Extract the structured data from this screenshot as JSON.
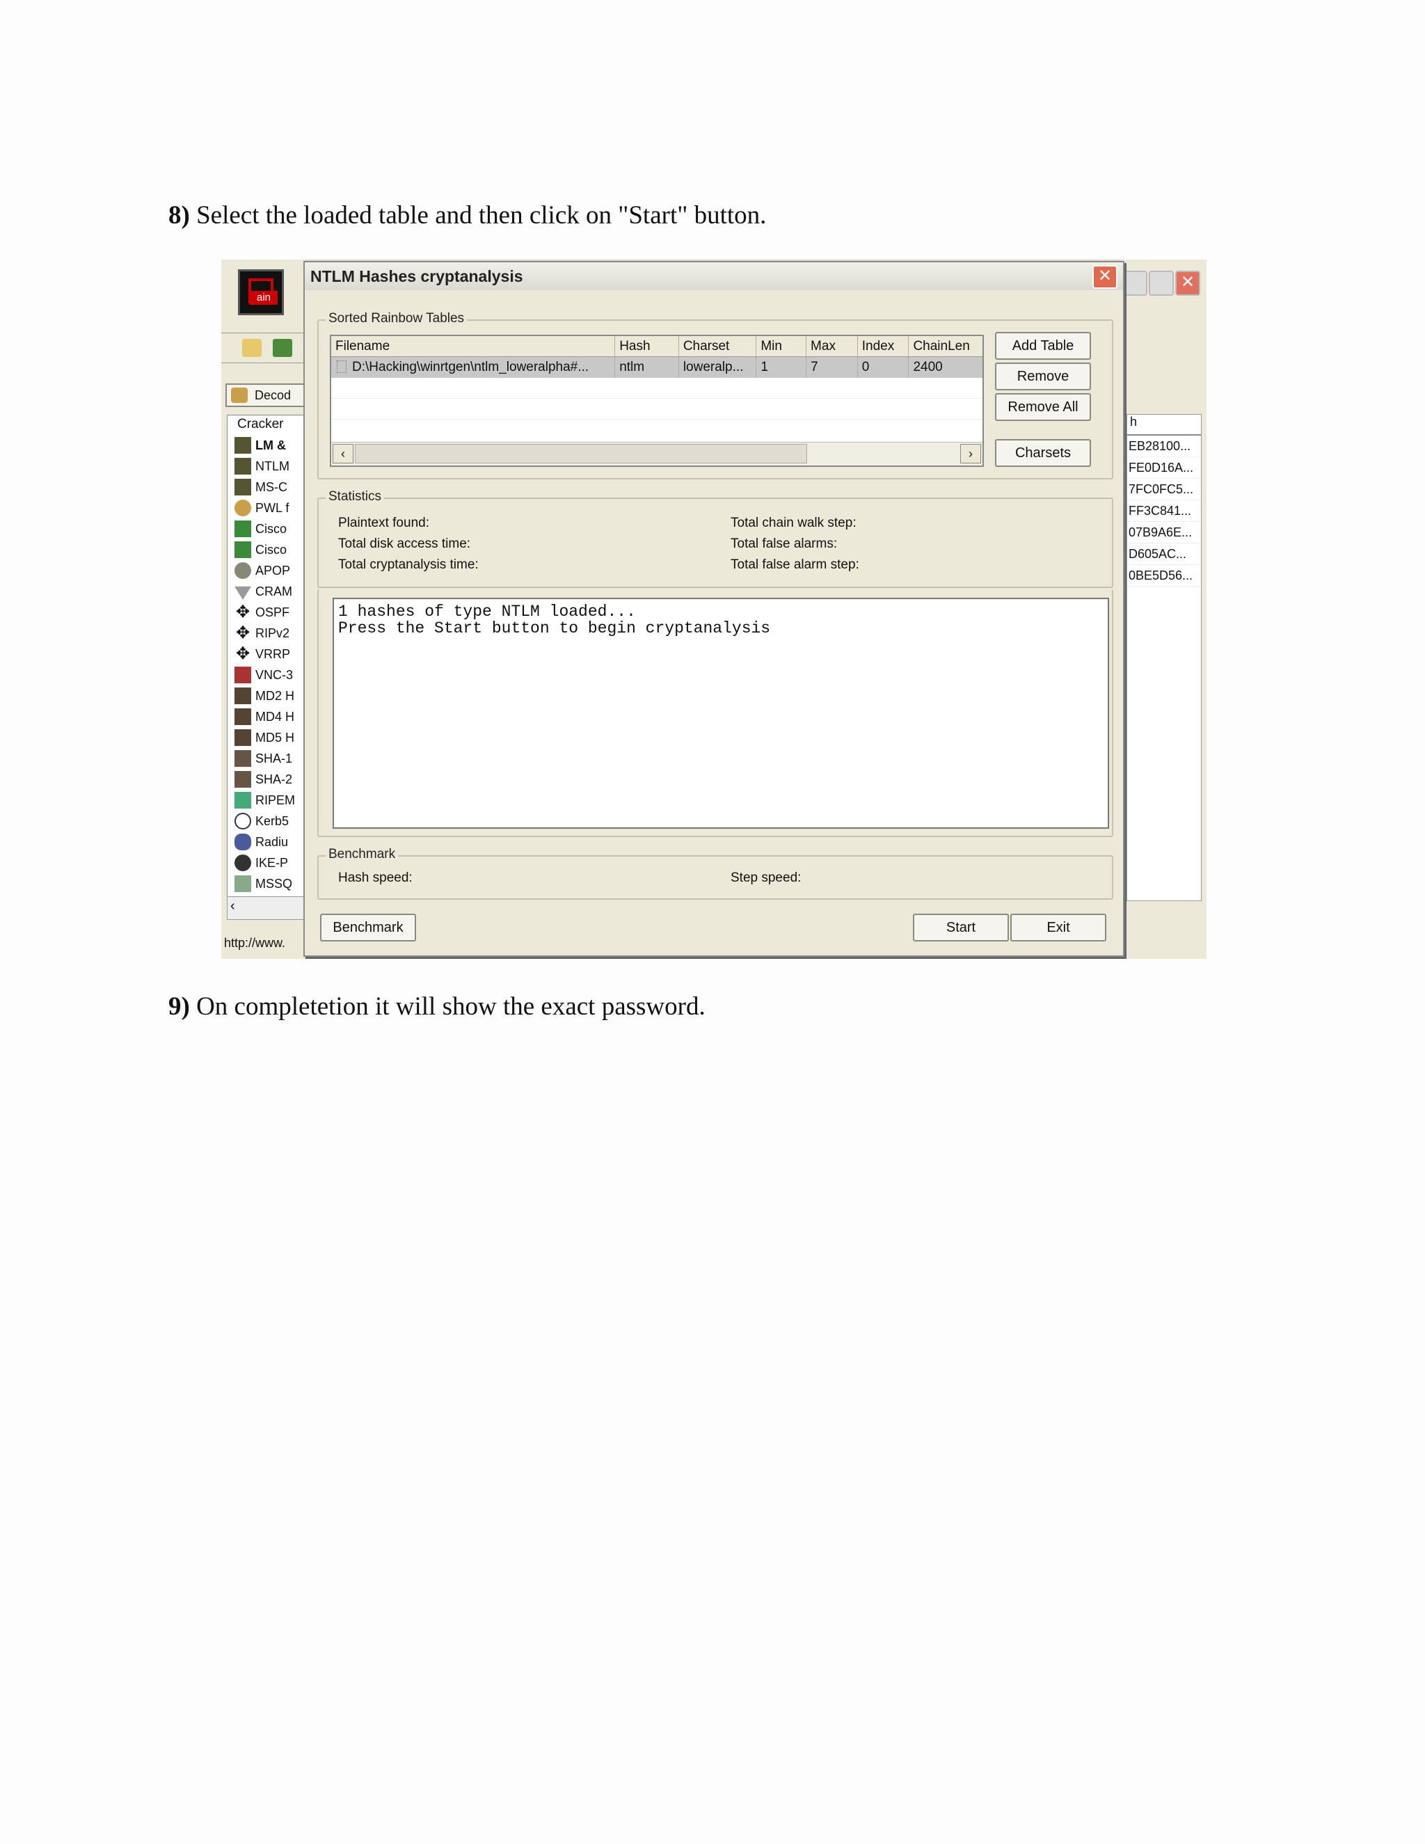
{
  "document": {
    "step8": {
      "num": "8)",
      "text": " Select the loaded table and then click on \"Start\" button."
    },
    "step9": {
      "num": "9)",
      "text": " On completetion it will show the exact password."
    }
  },
  "background_window": {
    "logo_text": "ain",
    "decod_tab": "Decod",
    "tree_title": "Cracker",
    "tree_items": [
      "LM &",
      "NTLM",
      "MS-C",
      "PWL f",
      "Cisco",
      "Cisco",
      "APOP",
      "CRAM",
      "OSPF",
      "RIPv2",
      "VRRP",
      "VNC-3",
      "MD2 H",
      "MD4 H",
      "MD5 H",
      "SHA-1",
      "SHA-2",
      "RIPEM",
      "Kerb5",
      "Radiu",
      "IKE-P",
      "MSSQ"
    ],
    "status": "http://www.",
    "list_header": "h",
    "list_rows": [
      "EB28100...",
      "FE0D16A...",
      "7FC0FC5...",
      "FF3C841...",
      "07B9A6E...",
      "D605AC...",
      "0BE5D56..."
    ]
  },
  "dialog": {
    "title": "NTLM Hashes cryptanalysis",
    "rainbow_group": "Sorted Rainbow Tables",
    "columns": [
      "Filename",
      "Hash",
      "Charset",
      "Min",
      "Max",
      "Index",
      "ChainLen"
    ],
    "rows": [
      [
        "D:\\Hacking\\winrtgen\\ntlm_loweralpha#...",
        "ntlm",
        "loweralp...",
        "1",
        "7",
        "0",
        "2400"
      ]
    ],
    "buttons": {
      "add_table": "Add Table",
      "remove": "Remove",
      "remove_all": "Remove All",
      "charsets": "Charsets",
      "benchmark": "Benchmark",
      "start": "Start",
      "exit": "Exit"
    },
    "statistics_group": "Statistics",
    "stats": {
      "plaintext_found": "Plaintext found:",
      "disk_access_time": "Total disk access time:",
      "cryptanalysis_time": "Total cryptanalysis time:",
      "chain_walk_step": "Total chain walk step:",
      "false_alarms": "Total false alarms:",
      "false_alarm_step": "Total false alarm step:"
    },
    "log": [
      "1 hashes of type NTLM loaded...",
      "Press the Start button to begin cryptanalysis"
    ],
    "benchmark_group": "Benchmark",
    "hash_speed": "Hash speed:",
    "step_speed": "Step speed:"
  }
}
